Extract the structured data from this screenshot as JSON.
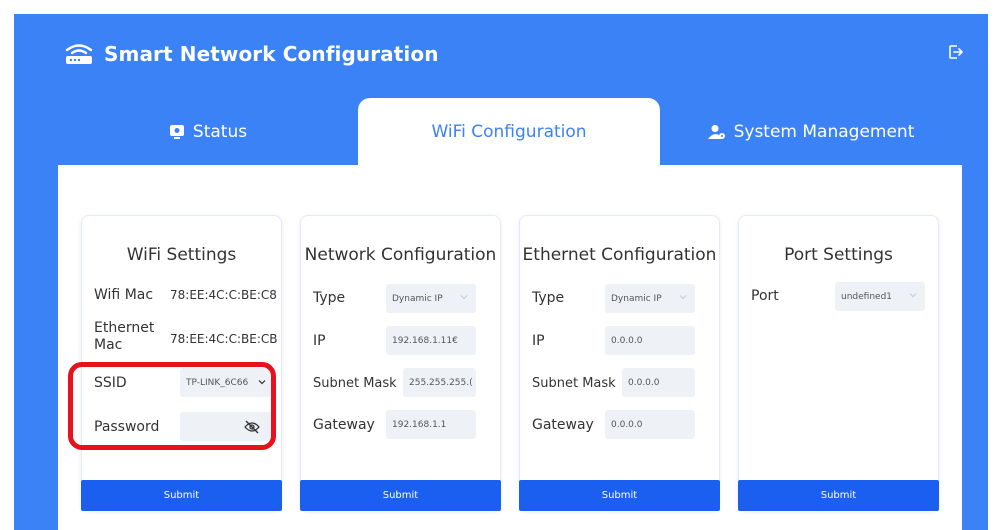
{
  "app": {
    "title": "Smart Network Configuration"
  },
  "tabs": {
    "status": "Status",
    "wifi": "WiFi Configuration",
    "system": "System Management"
  },
  "wifi_settings": {
    "title": "WiFi Settings",
    "wifi_mac_label": "Wifi Mac",
    "wifi_mac_value": "78:EE:4C:C:BE:C8",
    "ethernet_mac_label_line1": "Ethernet",
    "ethernet_mac_label_line2": "Mac",
    "ethernet_mac_value": "78:EE:4C:C:BE:CB",
    "ssid_label": "SSID",
    "ssid_value": "TP-LINK_6C66",
    "password_label": "Password",
    "submit": "Submit"
  },
  "network_configuration": {
    "title": "Network Configuration",
    "type_label": "Type",
    "type_value": "Dynamic IP",
    "ip_label": "IP",
    "ip_value": "192.168.1.11€",
    "subnet_label": "Subnet Mask",
    "subnet_value": "255.255.255.(",
    "gateway_label": "Gateway",
    "gateway_value": "192.168.1.1",
    "submit": "Submit"
  },
  "ethernet_configuration": {
    "title": "Ethernet Configuration",
    "type_label": "Type",
    "type_value": "Dynamic IP",
    "ip_label": "IP",
    "ip_value": "0.0.0.0",
    "subnet_label": "Subnet Mask",
    "subnet_value": "0.0.0.0",
    "gateway_label": "Gateway",
    "gateway_value": "0.0.0.0",
    "submit": "Submit"
  },
  "port_settings": {
    "title": "Port Settings",
    "port_label": "Port",
    "port_value": "undefined1",
    "submit": "Submit"
  },
  "colors": {
    "primary": "#3b82f6",
    "button": "#1b5ff0",
    "highlight": "#e8121d"
  }
}
